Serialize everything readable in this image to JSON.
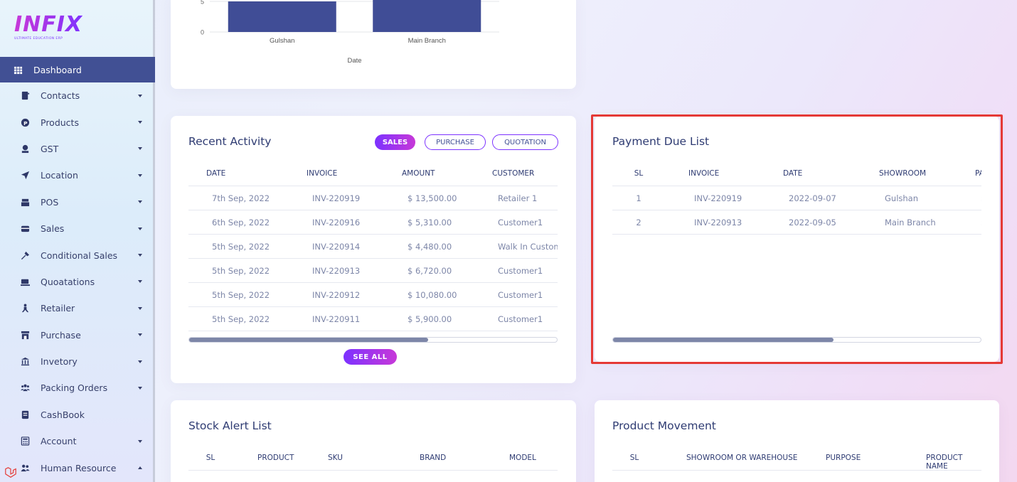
{
  "brand": {
    "logo_text": "INFIX",
    "tagline": "ULTIMATE EDUCATION ERP"
  },
  "sidebar": {
    "items": [
      {
        "label": "Dashboard",
        "icon": "grid-icon",
        "active": true
      },
      {
        "label": "Contacts",
        "icon": "contact-book-icon",
        "dropdown": true
      },
      {
        "label": "Products",
        "icon": "product-p-icon",
        "dropdown": true
      },
      {
        "label": "GST",
        "icon": "gst-icon",
        "dropdown": true
      },
      {
        "label": "Location",
        "icon": "location-arrow-icon",
        "dropdown": true
      },
      {
        "label": "POS",
        "icon": "pos-icon",
        "dropdown": true
      },
      {
        "label": "Sales",
        "icon": "sales-icon",
        "dropdown": true
      },
      {
        "label": "Conditional Sales",
        "icon": "gavel-icon",
        "dropdown": true
      },
      {
        "label": "Quoatations",
        "icon": "quotation-icon",
        "dropdown": true
      },
      {
        "label": "Retailer",
        "icon": "retailer-icon",
        "dropdown": true
      },
      {
        "label": "Purchase",
        "icon": "store-icon",
        "dropdown": true
      },
      {
        "label": "Invetory",
        "icon": "inventory-icon",
        "dropdown": true
      },
      {
        "label": "Packing Orders",
        "icon": "users-icon",
        "dropdown": true
      },
      {
        "label": "CashBook",
        "icon": "book-icon",
        "dropdown": false
      },
      {
        "label": "Account",
        "icon": "calculator-icon",
        "dropdown": true
      },
      {
        "label": "Human Resource",
        "icon": "people-icon",
        "dropdown": true,
        "expanded": true
      }
    ]
  },
  "chart_data": {
    "type": "bar",
    "categories": [
      "Gulshan",
      "Main Branch"
    ],
    "values": [
      5,
      6
    ],
    "xlabel": "Date",
    "visible_y_ticks": [
      "5",
      "0"
    ],
    "bar_color": "#404d96"
  },
  "recent_activity": {
    "title": "Recent Activity",
    "tabs": [
      "SALES",
      "PURCHASE",
      "QUOTATION"
    ],
    "active_tab": "SALES",
    "columns": [
      "DATE",
      "INVOICE",
      "AMOUNT",
      "CUSTOMER"
    ],
    "rows": [
      [
        "7th Sep, 2022",
        "INV-220919",
        "$ 13,500.00",
        "Retailer 1"
      ],
      [
        "6th Sep, 2022",
        "INV-220916",
        "$ 5,310.00",
        "Customer1"
      ],
      [
        "5th Sep, 2022",
        "INV-220914",
        "$ 4,480.00",
        "Walk In Customer"
      ],
      [
        "5th Sep, 2022",
        "INV-220913",
        "$ 6,720.00",
        "Customer1"
      ],
      [
        "5th Sep, 2022",
        "INV-220912",
        "$ 10,080.00",
        "Customer1"
      ],
      [
        "5th Sep, 2022",
        "INV-220911",
        "$ 5,900.00",
        "Customer1"
      ]
    ],
    "see_all_label": "SEE ALL",
    "scroll_fraction": 0.65
  },
  "payment_due": {
    "title": "Payment Due List",
    "columns": [
      "SL",
      "INVOICE",
      "DATE",
      "SHOWROOM",
      "PAYMENT"
    ],
    "rows": [
      [
        "1",
        "INV-220919",
        "2022-09-07",
        "Gulshan",
        "$"
      ],
      [
        "2",
        "INV-220913",
        "2022-09-05",
        "Main Branch",
        "$"
      ]
    ],
    "scroll_fraction": 0.6
  },
  "stock_alert": {
    "title": "Stock Alert List",
    "columns": [
      "SL",
      "PRODUCT",
      "SKU",
      "BRAND",
      "MODEL"
    ]
  },
  "product_movement": {
    "title": "Product Movement",
    "columns": [
      "SL",
      "SHOWROOM OR WAREHOUSE",
      "PURPOSE",
      "PRODUCT NAME"
    ]
  },
  "colors": {
    "primary": "#415094",
    "accent_start": "#7c32ff",
    "accent_end": "#c738d8",
    "highlight": "#e53935"
  }
}
